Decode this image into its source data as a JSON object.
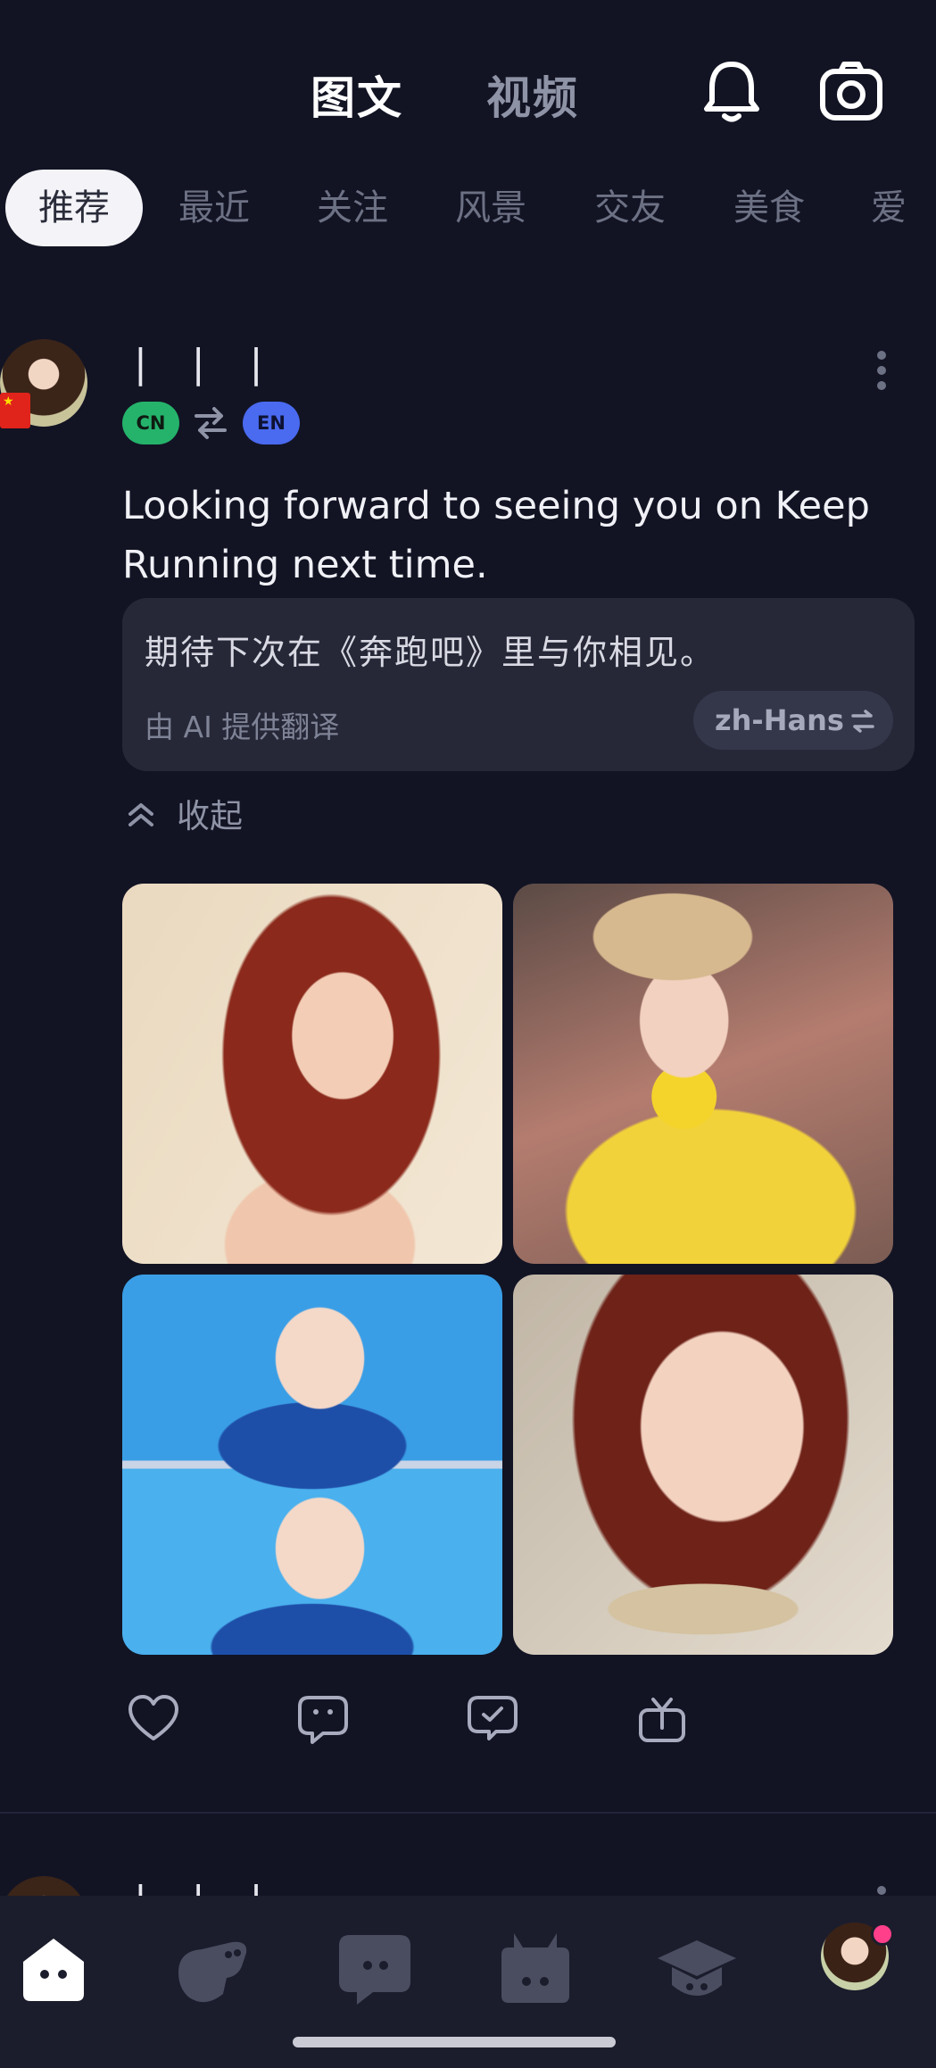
{
  "header": {
    "tabs": [
      {
        "label": "图文",
        "active": true
      },
      {
        "label": "视频",
        "active": false
      }
    ],
    "icons": [
      "bell-icon",
      "camera-icon"
    ]
  },
  "categories": [
    "推荐",
    "最近",
    "关注",
    "风景",
    "交友",
    "美食",
    "爱"
  ],
  "post": {
    "username": "| | |",
    "country_flag": "CN",
    "source_lang": "CN",
    "target_lang": "EN",
    "text": "Looking forward to seeing you on Keep Running next time.",
    "translation": {
      "text": "期待下次在《奔跑吧》里与你相见。",
      "credit": "由 AI 提供翻译",
      "lang": "zh-Hans"
    },
    "collapse_label": "收起",
    "photo_count": 4
  },
  "next_post": {
    "username": "| | |"
  },
  "bottom_nav": {
    "items": [
      "home-icon",
      "game-icon",
      "chat-icon",
      "bag-icon",
      "learn-icon",
      "profile-avatar"
    ],
    "profile_notification": true
  },
  "colors": {
    "background": "#121424",
    "card": "#262838",
    "badge_cn": "#25b36b",
    "badge_en": "#4a6af0",
    "notification_dot": "#ff3f8a"
  }
}
